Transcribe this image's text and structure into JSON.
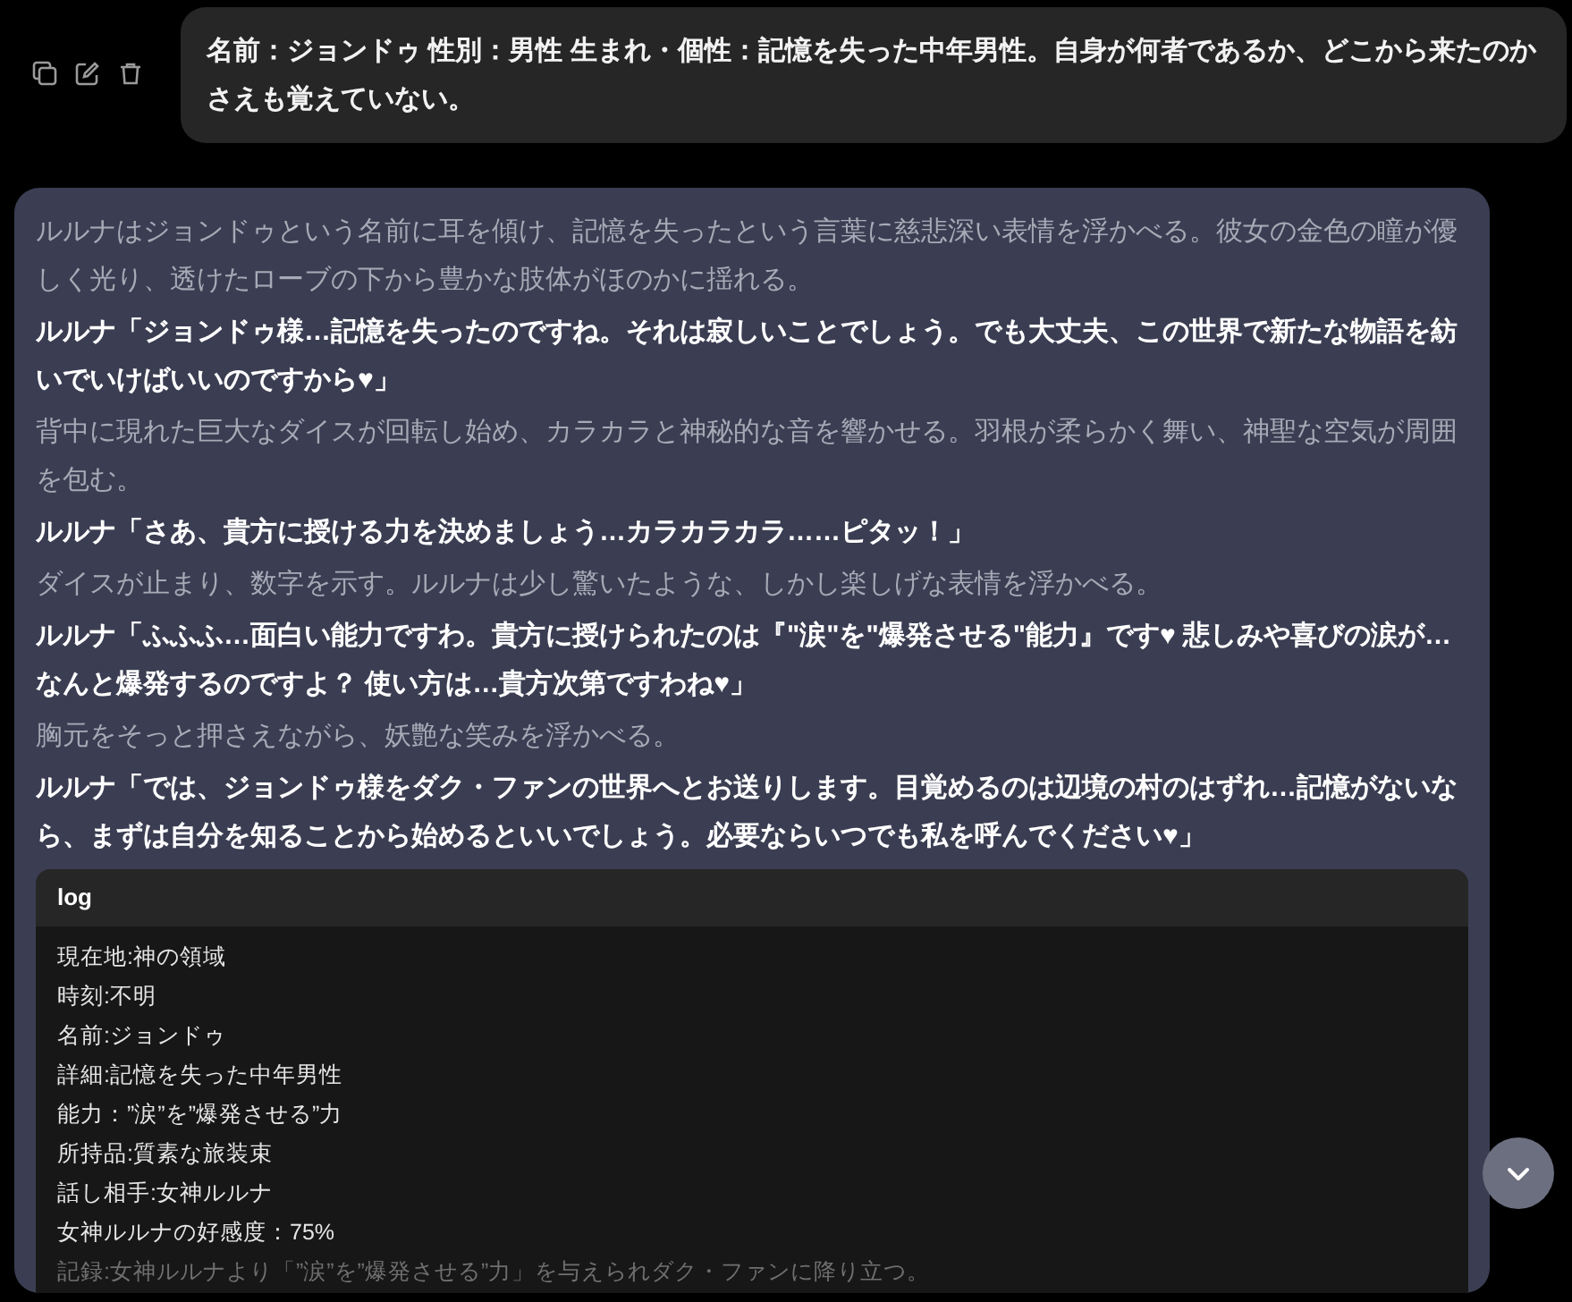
{
  "user_message": {
    "text": "名前：ジョンドゥ 性別：男性 生まれ・個性：記憶を失った中年男性。自身が何者であるか、どこから来たのかさえも覚えていない。"
  },
  "assistant_message": {
    "paragraphs": [
      {
        "kind": "narration",
        "text": "ルルナはジョンドゥという名前に耳を傾け、記憶を失ったという言葉に慈悲深い表情を浮かべる。彼女の金色の瞳が優しく光り、透けたローブの下から豊かな肢体がほのかに揺れる。"
      },
      {
        "kind": "dialogue",
        "text": "ルルナ「ジョンドゥ様…記憶を失ったのですね。それは寂しいことでしょう。でも大丈夫、この世界で新たな物語を紡いでいけばいいのですから♥」"
      },
      {
        "kind": "narration",
        "text": "背中に現れた巨大なダイスが回転し始め、カラカラと神秘的な音を響かせる。羽根が柔らかく舞い、神聖な空気が周囲を包む。"
      },
      {
        "kind": "dialogue",
        "text": "ルルナ「さあ、貴方に授ける力を決めましょう…カラカラカラ……ピタッ！」"
      },
      {
        "kind": "narration",
        "text": "ダイスが止まり、数字を示す。ルルナは少し驚いたような、しかし楽しげな表情を浮かべる。"
      },
      {
        "kind": "dialogue",
        "text": "ルルナ「ふふふ…面白い能力ですわ。貴方に授けられたのは『\"涙\"を\"爆発させる\"能力』です♥ 悲しみや喜びの涙が…なんと爆発するのですよ？ 使い方は…貴方次第ですわね♥」"
      },
      {
        "kind": "narration",
        "text": "胸元をそっと押さえながら、妖艶な笑みを浮かべる。"
      },
      {
        "kind": "dialogue",
        "text": "ルルナ「では、ジョンドゥ様をダク・ファンの世界へとお送りします。目覚めるのは辺境の村のはずれ…記憶がないなら、まずは自分を知ることから始めるといいでしょう。必要ならいつでも私を呼んでください♥」"
      }
    ],
    "log": {
      "title": "log",
      "lines": [
        {
          "text": "現在地:神の領域",
          "faded": false
        },
        {
          "text": "時刻:不明",
          "faded": false
        },
        {
          "text": "名前:ジョンドゥ",
          "faded": false
        },
        {
          "text": "詳細:記憶を失った中年男性",
          "faded": false
        },
        {
          "text": "能力：”涙”を”爆発させる”力",
          "faded": false
        },
        {
          "text": "所持品:質素な旅装束",
          "faded": false
        },
        {
          "text": "話し相手:女神ルルナ",
          "faded": false
        },
        {
          "text": "女神ルルナの好感度：75%",
          "faded": false
        },
        {
          "text": "記録:女神ルルナより「”涙”を”爆発させる”力」を与えられダク・ファンに降り立つ。",
          "faded": true
        }
      ]
    }
  }
}
